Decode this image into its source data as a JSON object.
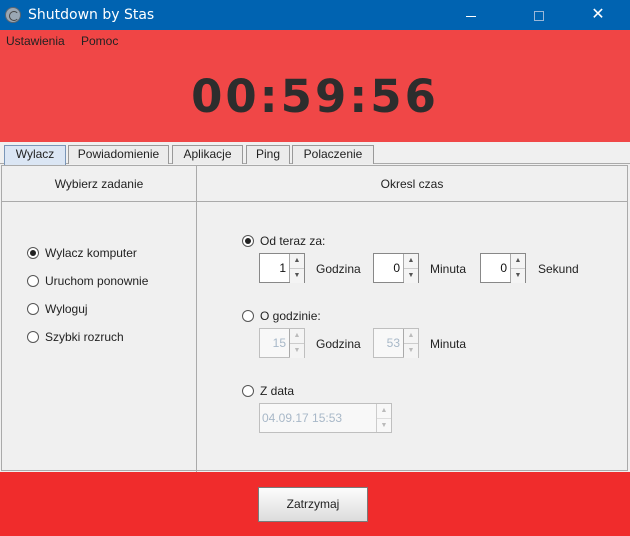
{
  "window": {
    "title": "Shutdown by Stas",
    "controls": [
      "minimize",
      "maximize",
      "close"
    ],
    "close_glyph": "✕"
  },
  "menu": {
    "items": [
      "Ustawienia",
      "Pomoc"
    ]
  },
  "timer": {
    "value": "00:59:56"
  },
  "tabs": [
    {
      "label": "Wylacz",
      "active": true
    },
    {
      "label": "Powiadomienie",
      "active": false
    },
    {
      "label": "Aplikacje",
      "active": false
    },
    {
      "label": "Ping",
      "active": false
    },
    {
      "label": "Polaczenie",
      "active": false
    }
  ],
  "left_panel": {
    "header": "Wybierz zadanie",
    "options": [
      {
        "label": "Wylacz komputer",
        "checked": true
      },
      {
        "label": "Uruchom ponownie",
        "checked": false
      },
      {
        "label": "Wyloguj",
        "checked": false
      },
      {
        "label": "Szybki rozruch",
        "checked": false
      }
    ]
  },
  "right_panel": {
    "header": "Okresl czas",
    "from_now": {
      "label": "Od teraz za:",
      "checked": true,
      "hours": {
        "value": "1",
        "unit": "Godzina"
      },
      "minutes": {
        "value": "0",
        "unit": "Minuta"
      },
      "seconds": {
        "value": "0",
        "unit": "Sekund"
      }
    },
    "at_time": {
      "label": "O godzinie:",
      "checked": false,
      "hours": {
        "value": "15",
        "unit": "Godzina"
      },
      "minutes": {
        "value": "53",
        "unit": "Minuta"
      }
    },
    "from_date": {
      "label": "Z data",
      "checked": false,
      "value": "04.09.17 15:53"
    }
  },
  "actions": {
    "stop_label": "Zatrzymaj"
  },
  "colors": {
    "titlebar": "#0063b1",
    "red_panel": "#f04747",
    "bottom_panel": "#f02c2c"
  }
}
